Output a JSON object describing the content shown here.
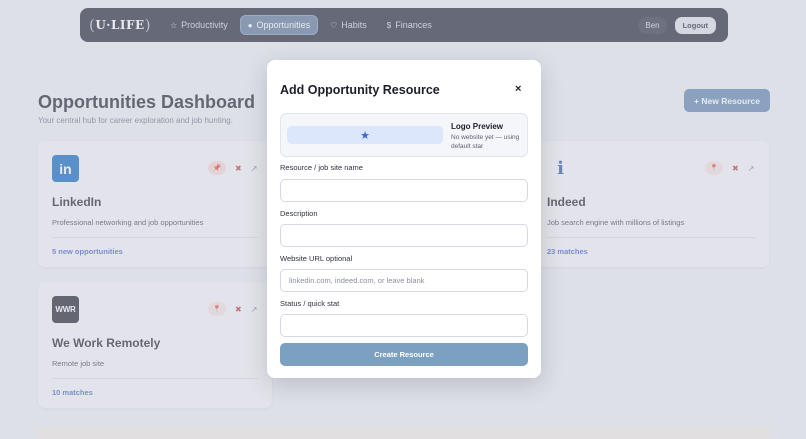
{
  "nav": {
    "logo_text": "U·LIFE",
    "items": [
      {
        "icon": "star-outline-icon",
        "glyph": "☆",
        "label": "Productivity"
      },
      {
        "icon": "dot-icon",
        "glyph": "●",
        "label": "Opportunities"
      },
      {
        "icon": "heart-icon",
        "glyph": "♡",
        "label": "Habits"
      },
      {
        "icon": "dollar-icon",
        "glyph": "$",
        "label": "Finances"
      }
    ],
    "user": "Ben",
    "logout_label": "Logout"
  },
  "page": {
    "title": "Opportunities Dashboard",
    "subtitle": "Your central hub for career exploration and job hunting.",
    "new_button_label": "+ New Resource"
  },
  "cards": [
    {
      "logo": "in",
      "logo_color": "#0a66c2",
      "name": "LinkedIn",
      "description": "Professional networking and job opportunities",
      "stat": "5 new opportunities",
      "pinned": true
    },
    {
      "logo": "i",
      "logo_color": "#2557a7",
      "name": "Indeed",
      "description": "Job search engine with millions of listings",
      "stat": "23 matches",
      "pinned": false
    },
    {
      "logo": "WWR",
      "logo_color": "#1c1f2a",
      "name": "We Work Remotely",
      "description": "Remote job site",
      "stat": "10 matches",
      "pinned": false
    }
  ],
  "modal": {
    "title": "Add Opportunity Resource",
    "close_glyph": "×",
    "preview": {
      "glyph": "★",
      "title": "Logo Preview",
      "note": "No website yet — using default star"
    },
    "fields": [
      {
        "label": "Resource / job site name",
        "value": "",
        "placeholder": ""
      },
      {
        "label": "Description",
        "value": "",
        "placeholder": ""
      },
      {
        "label": "Website URL optional",
        "value": "",
        "placeholder": "linkedin.com, indeed.com, or leave blank"
      },
      {
        "label": "Status / quick stat",
        "value": "",
        "placeholder": ""
      }
    ],
    "submit_label": "Create Resource"
  },
  "colors": {
    "nav_bg": "#1f2433",
    "nav_active": "#5a7596",
    "accent": "#5e86b0",
    "stat_link": "#3f63c8",
    "danger": "#c53a3a",
    "submit": "#7ca0bf"
  }
}
